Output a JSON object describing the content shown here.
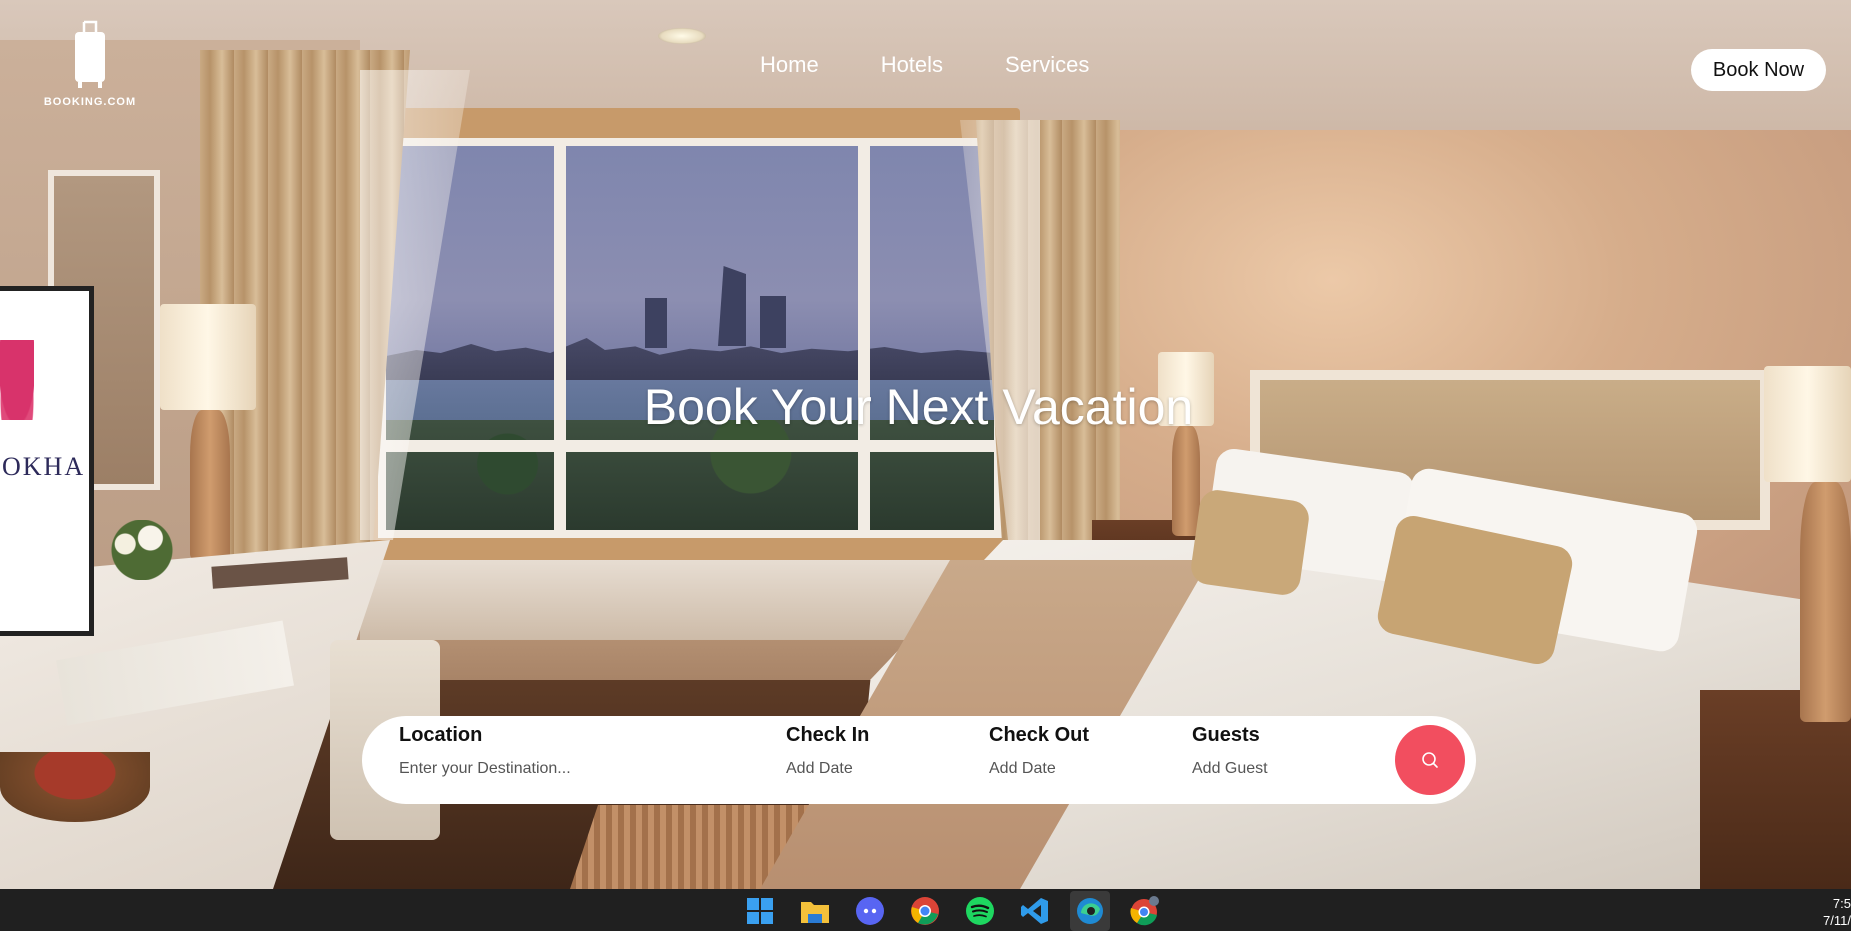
{
  "brand": {
    "logo_text": "BOOKING.COM"
  },
  "nav": {
    "items": [
      {
        "label": "Home"
      },
      {
        "label": "Hotels"
      },
      {
        "label": "Services"
      }
    ],
    "cta_label": "Book Now"
  },
  "hero": {
    "title": "Book Your Next Vacation",
    "tv_text": "OKHA"
  },
  "search": {
    "location_label": "Location",
    "location_placeholder": "Enter your Destination...",
    "checkin_label": "Check In",
    "checkin_value": "Add Date",
    "checkout_label": "Check Out",
    "checkout_value": "Add Date",
    "guests_label": "Guests",
    "guests_value": "Add Guest",
    "button_icon": "search-icon",
    "button_color": "#f24e5f"
  },
  "taskbar": {
    "apps": [
      {
        "name": "windows-start-icon"
      },
      {
        "name": "file-explorer-icon"
      },
      {
        "name": "discord-icon"
      },
      {
        "name": "chrome-icon"
      },
      {
        "name": "spotify-icon"
      },
      {
        "name": "vscode-icon"
      },
      {
        "name": "edge-icon"
      },
      {
        "name": "chrome-profile-icon"
      }
    ],
    "clock_time": "7:5",
    "clock_date": "7/11/"
  }
}
